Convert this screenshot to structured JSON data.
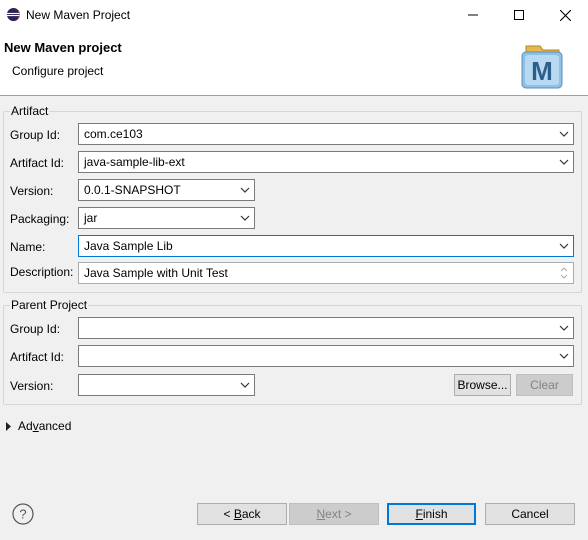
{
  "window": {
    "title": "New Maven Project"
  },
  "header": {
    "title": "New Maven project",
    "subtitle": "Configure project"
  },
  "artifact": {
    "group_title": "Artifact",
    "group_id_label": "Group Id:",
    "group_id_value": "com.ce103",
    "artifact_id_label": "Artifact Id:",
    "artifact_id_value": "java-sample-lib-ext",
    "version_label": "Version:",
    "version_value": "0.0.1-SNAPSHOT",
    "packaging_label": "Packaging:",
    "packaging_value": "jar",
    "name_label": "Name:",
    "name_value": "Java Sample Lib",
    "description_label": "Description:",
    "description_value": "Java Sample with Unit Test"
  },
  "parent": {
    "group_title": "Parent Project",
    "group_id_label": "Group Id:",
    "group_id_value": "",
    "artifact_id_label": "Artifact Id:",
    "artifact_id_value": "",
    "version_label": "Version:",
    "version_value": "",
    "browse_label": "Browse...",
    "clear_label": "Clear"
  },
  "advanced": {
    "label_pre": "Ad",
    "label_mnemonic": "v",
    "label_post": "anced"
  },
  "footer": {
    "back_label_pre": "< ",
    "back_mnemonic": "B",
    "back_label_post": "ack",
    "next_mnemonic": "N",
    "next_label_post": "ext >",
    "finish_mnemonic": "F",
    "finish_label_post": "inish",
    "cancel_label": "Cancel"
  },
  "icons": {
    "app": "eclipse-icon",
    "help": "help-icon",
    "logo": "maven-logo"
  }
}
